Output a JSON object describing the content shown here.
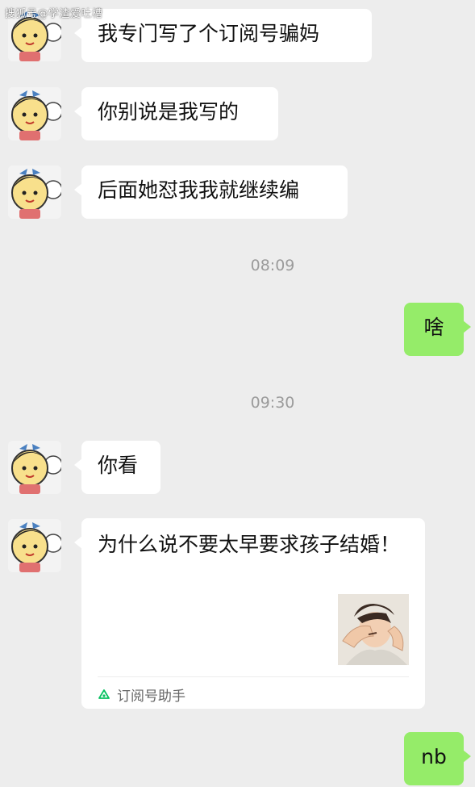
{
  "watermark": "搜狐号@学渣爱吐槽",
  "messages": [
    {
      "text": "我专门写了个订阅号骗妈"
    },
    {
      "text": "你别说是我写的"
    },
    {
      "text": "后面她怼我我就继续编"
    },
    {
      "time": "08:09"
    },
    {
      "text": "啥"
    },
    {
      "time": "09:30"
    },
    {
      "text": "你看"
    },
    {
      "text": "nb"
    }
  ],
  "article_card": {
    "title": "为什么说不要太早要求孩子结婚！",
    "source": "订阅号助手",
    "source_icon": "subscription-assistant-icon",
    "thumbnail_icon": "facepalm-person-icon"
  },
  "colors": {
    "background": "#ededed",
    "incoming_bubble": "#ffffff",
    "outgoing_bubble": "#95ec69",
    "timestamp": "#9b9b9b"
  }
}
